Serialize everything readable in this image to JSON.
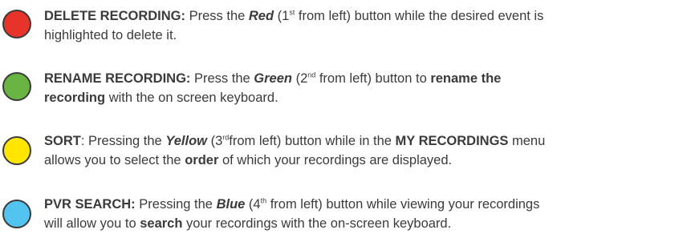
{
  "colors": {
    "red": "#e8332a",
    "green": "#6ab444",
    "yellow": "#ffe600",
    "blue": "#52c4ef",
    "text": "#3b3b3b"
  },
  "items": [
    {
      "icon": "red-circle-icon",
      "title": "DELETE RECORDING:",
      "p1": " Press the ",
      "color_word": "Red",
      "p2": " (1",
      "sup": "st",
      "p3": " from left) button while the desired event is",
      "line2": "highlighted to delete it."
    },
    {
      "icon": "green-circle-icon",
      "title": "RENAME RECORDING:",
      "p1": " Press the ",
      "color_word": "Green",
      "p2": " (2",
      "sup": "nd",
      "p3": " from left) button to ",
      "bold1": "rename the",
      "bold2": "recording",
      "line2": " with the on screen keyboard."
    },
    {
      "icon": "yellow-circle-icon",
      "title": "SORT",
      "p1": ": Pressing the ",
      "color_word": "Yellow",
      "p2": " (3",
      "sup": "rd",
      "p3": "from left) button while in the ",
      "bold1": "MY RECORDINGS",
      "p4": " menu",
      "line2a": "allows you to select the ",
      "bold2": "order",
      "line2b": " of which your recordings are displayed."
    },
    {
      "icon": "blue-circle-icon",
      "title": "PVR SEARCH:",
      "p1": " Pressing the ",
      "color_word": "Blue",
      "p2": " (4",
      "sup": "th",
      "p3": " from left) button while viewing your recordings",
      "line2a": "will allow you to ",
      "bold1": "search",
      "line2b": " your recordings with the on-screen keyboard."
    }
  ]
}
